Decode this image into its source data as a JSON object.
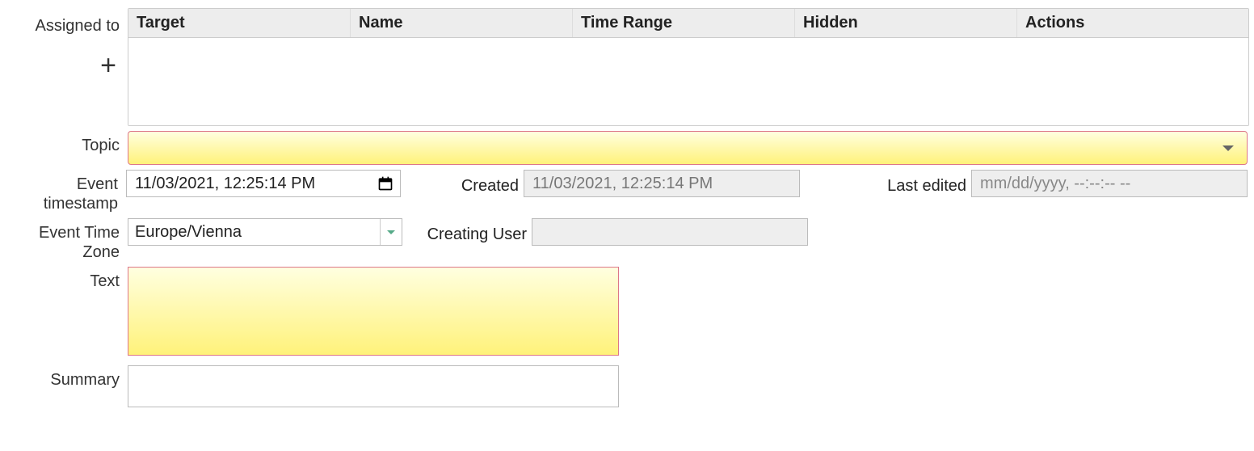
{
  "assigned": {
    "label": "Assigned to",
    "columns": {
      "target": "Target",
      "name": "Name",
      "time": "Time Range",
      "hidden": "Hidden",
      "actions": "Actions"
    },
    "add_label": "+"
  },
  "topic": {
    "label": "Topic",
    "value": ""
  },
  "event_timestamp": {
    "label": "Event timestamp",
    "value": "11/03/2021, 12:25:14 PM"
  },
  "created": {
    "label": "Created",
    "value": "11/03/2021, 12:25:14 PM"
  },
  "last_edited": {
    "label": "Last edited",
    "placeholder": "mm/dd/yyyy, --:--:-- --",
    "value": ""
  },
  "timezone": {
    "label": "Event Time Zone",
    "value": "Europe/Vienna"
  },
  "creating_user": {
    "label": "Creating User",
    "value": ""
  },
  "text": {
    "label": "Text",
    "value": ""
  },
  "summary": {
    "label": "Summary",
    "value": ""
  }
}
